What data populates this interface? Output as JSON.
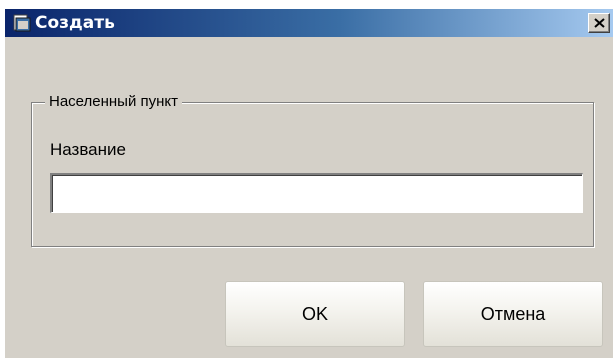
{
  "window": {
    "title": "Создать"
  },
  "group": {
    "legend": "Населенный пункт",
    "field_label": "Название",
    "field_value": ""
  },
  "buttons": {
    "ok_label": "OK",
    "cancel_label": "Отмена"
  },
  "icons": {
    "app": "folder-icon",
    "close": "close-icon"
  },
  "colors": {
    "titlebar_start": "#0a246a",
    "titlebar_end": "#a6caf0",
    "dialog_background": "#d4d0c8"
  }
}
